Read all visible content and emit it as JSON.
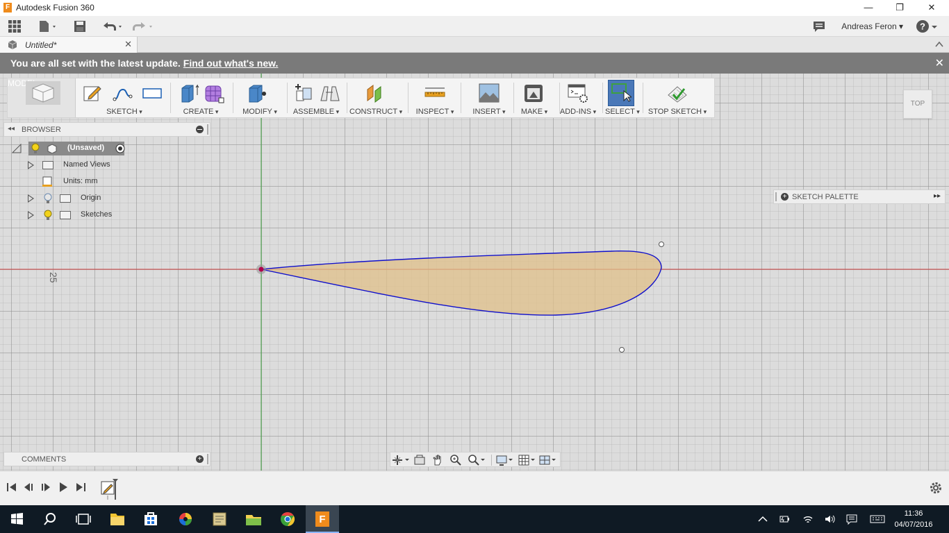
{
  "window": {
    "title": "Autodesk Fusion 360",
    "app_icon_letter": "F",
    "minimize": "—",
    "restore": "❐",
    "close": "✕"
  },
  "qat": {
    "user": "Andreas Feron ▾",
    "help": "? ▾"
  },
  "tab": {
    "title": "Untitled*",
    "close": "✕"
  },
  "notice": {
    "text": "You are all set with the latest update.",
    "link": "Find out what's new.",
    "close": "✕"
  },
  "toolbar": {
    "workspace": "MODEL",
    "groups": [
      "SKETCH",
      "CREATE",
      "MODIFY",
      "ASSEMBLE",
      "CONSTRUCT",
      "INSPECT",
      "INSERT",
      "MAKE",
      "ADD-INS",
      "SELECT"
    ],
    "stop_sketch": "STOP SKETCH"
  },
  "viewcube": {
    "face": "TOP"
  },
  "browser": {
    "title": "BROWSER",
    "collapse": "◂◂",
    "root": "(Unsaved)",
    "items": [
      "Named Views",
      "Units: mm",
      "Origin",
      "Sketches"
    ]
  },
  "canvas": {
    "dimension_label": "25",
    "colors": {
      "profile_fill": "#e0c08a",
      "profile_stroke": "#1010cc",
      "x_axis": "#d04040",
      "y_axis": "#3aa03a",
      "origin": "#b0004a"
    }
  },
  "palette": {
    "title": "SKETCH PALETTE",
    "plus": "+",
    "expand": "▸▸"
  },
  "comments": {
    "title": "COMMENTS",
    "plus": "+"
  },
  "taskbar": {
    "time": "11:36",
    "date": "04/07/2016"
  },
  "icons": {
    "qat": [
      "grid-apps-icon",
      "file-icon",
      "save-icon",
      "undo-icon",
      "redo-icon"
    ],
    "nav": [
      "orbit-icon",
      "look-at-icon",
      "pan-icon",
      "zoom-icon",
      "fit-icon",
      "display-icon",
      "grid-icon",
      "viewports-icon"
    ],
    "timeline": [
      "first-icon",
      "previous-icon",
      "play-icon",
      "next-icon",
      "last-icon"
    ],
    "taskbar": [
      "windows-start-icon",
      "search-icon",
      "task-view-icon",
      "explorer-icon",
      "store-icon",
      "photos-icon",
      "notepad-icon",
      "folder-icon",
      "chrome-icon",
      "fusion-icon"
    ]
  }
}
